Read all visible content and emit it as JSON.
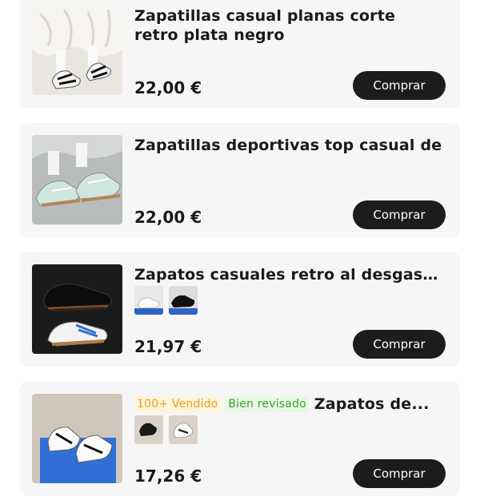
{
  "products": [
    {
      "title": "Zapatillas casual planas corte retro plata negro",
      "price": "22,00 €",
      "button": "Comprar",
      "image": "product-photo-silver-black-sneakers"
    },
    {
      "title": "Zapatillas deportivas top casual de",
      "price": "22,00 €",
      "button": "Comprar",
      "image": "product-photo-mint-sneakers"
    },
    {
      "title": "Zapatos casuales retro al desgaste...",
      "price": "21,97 €",
      "button": "Comprar",
      "image": "product-photo-black-white-sneakers"
    },
    {
      "title": "Zapatos de...",
      "badges": [
        "100+ Vendido",
        "Bien revisado"
      ],
      "price": "17,26 €",
      "button": "Comprar",
      "image": "product-photo-white-sneakers-box"
    }
  ],
  "colors": {
    "card_bg": "#f6f6f6",
    "button_bg": "#1c1c1c",
    "sold_badge": "#e8a11d",
    "review_badge": "#3aa230"
  }
}
